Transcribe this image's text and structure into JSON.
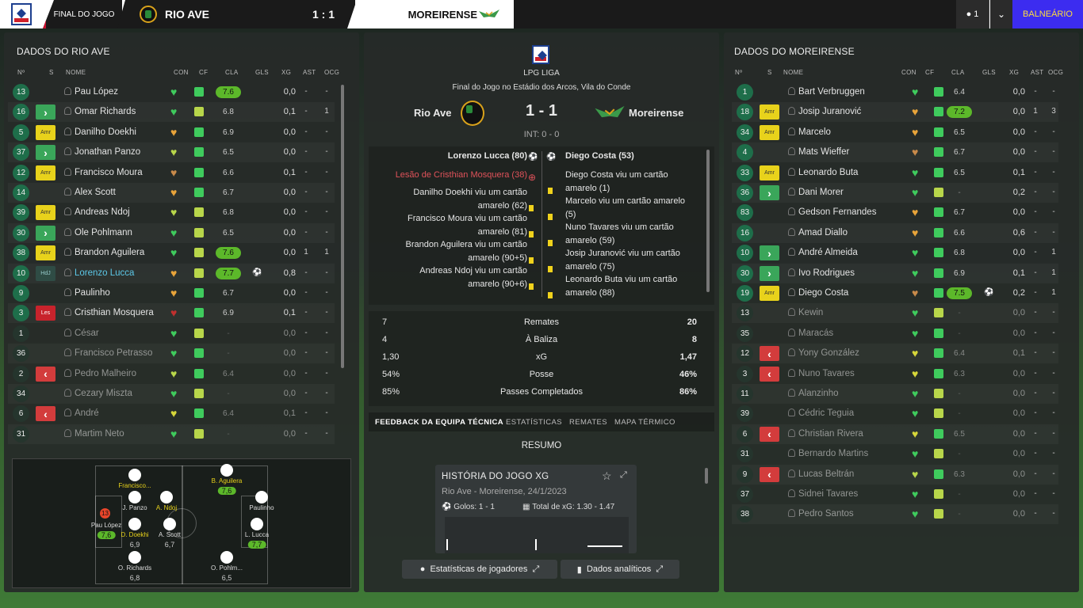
{
  "topbar": {
    "status": "FINAL DO JOGO",
    "home_team": "RIO AVE",
    "score": "1 : 1",
    "away_team": "MOREIRENSE",
    "user_count": "1",
    "action_label": "BALNEÁRIO"
  },
  "left": {
    "title": "DADOS DO RIO AVE",
    "headers": {
      "num": "Nº",
      "s": "S",
      "name": "NOME",
      "con": "CON",
      "cf": "CF",
      "cla": "CLA",
      "gls": "GLS",
      "xg": "XG",
      "ast": "AST",
      "ocg": "OCG"
    },
    "players": [
      {
        "num": "13",
        "status": "",
        "name": "Pau López",
        "cla": "7.6",
        "hi": true,
        "xg": "0,0",
        "ast": "-",
        "ocg": "-",
        "con": "#3fcb5d",
        "cf": "ok",
        "sub": false
      },
      {
        "num": "16",
        "status": "in",
        "name": "Omar Richards",
        "cla": "6.8",
        "xg": "0,1",
        "ast": "-",
        "ocg": "1",
        "con": "#3fcb5d",
        "cf": "mid",
        "sub": false
      },
      {
        "num": "5",
        "status": "Amr",
        "name": "Danilho Doekhi",
        "cla": "6.9",
        "xg": "0,0",
        "ast": "-",
        "ocg": "-",
        "con": "#e8a43a",
        "cf": "ok",
        "sub": false
      },
      {
        "num": "37",
        "status": "in",
        "name": "Jonathan Panzo",
        "cla": "6.5",
        "xg": "0,0",
        "ast": "-",
        "ocg": "-",
        "con": "#b8d64a",
        "cf": "ok",
        "sub": false
      },
      {
        "num": "12",
        "status": "Amr",
        "name": "Francisco Moura",
        "cla": "6.6",
        "xg": "0,1",
        "ast": "-",
        "ocg": "-",
        "con": "#c88a4a",
        "cf": "ok",
        "sub": false
      },
      {
        "num": "14",
        "status": "",
        "name": "Alex Scott",
        "cla": "6.7",
        "xg": "0,0",
        "ast": "-",
        "ocg": "-",
        "con": "#e8a43a",
        "cf": "ok",
        "sub": false
      },
      {
        "num": "39",
        "status": "Amr",
        "name": "Andreas Ndoj",
        "cla": "6.8",
        "xg": "0,0",
        "ast": "-",
        "ocg": "-",
        "con": "#b8d64a",
        "cf": "mid",
        "sub": false
      },
      {
        "num": "30",
        "status": "in",
        "name": "Ole Pohlmann",
        "cla": "6.5",
        "xg": "0,0",
        "ast": "-",
        "ocg": "-",
        "con": "#3fcb5d",
        "cf": "mid",
        "sub": false
      },
      {
        "num": "38",
        "status": "Amr",
        "name": "Brandon Aguilera",
        "cla": "7.6",
        "hi": true,
        "xg": "0,0",
        "ast": "1",
        "ocg": "1",
        "con": "#3fcb5d",
        "cf": "mid",
        "sub": false
      },
      {
        "num": "10",
        "status": "HdJ",
        "name": "Lorenzo Lucca",
        "cla": "7.7",
        "hi": true,
        "ball": true,
        "xg": "0,8",
        "ast": "-",
        "ocg": "-",
        "con": "#e8a43a",
        "cf": "mid",
        "sub": false,
        "highlight": true
      },
      {
        "num": "9",
        "status": "",
        "name": "Paulinho",
        "cla": "6.7",
        "xg": "0,0",
        "ast": "-",
        "ocg": "-",
        "con": "#e8a43a",
        "cf": "ok",
        "sub": false
      },
      {
        "num": "3",
        "status": "Les",
        "name": "Cristhian Mosquera",
        "cla": "6.9",
        "xg": "0,1",
        "ast": "-",
        "ocg": "-",
        "con": "#c0302e",
        "cf": "ok",
        "sub": false
      },
      {
        "num": "1",
        "status": "",
        "name": "César",
        "cla": "-",
        "xg": "0,0",
        "ast": "-",
        "ocg": "-",
        "con": "#3fcb5d",
        "cf": "mid",
        "sub": true
      },
      {
        "num": "36",
        "status": "",
        "name": "Francisco Petrasso",
        "cla": "-",
        "xg": "0,0",
        "ast": "-",
        "ocg": "-",
        "con": "#3fcb5d",
        "cf": "ok",
        "sub": true
      },
      {
        "num": "2",
        "status": "out",
        "name": "Pedro Malheiro",
        "cla": "6.4",
        "xg": "0,0",
        "ast": "-",
        "ocg": "-",
        "con": "#b8d64a",
        "cf": "ok",
        "sub": true
      },
      {
        "num": "34",
        "status": "",
        "name": "Cezary Miszta",
        "cla": "-",
        "xg": "0,0",
        "ast": "-",
        "ocg": "-",
        "con": "#3fcb5d",
        "cf": "mid",
        "sub": true
      },
      {
        "num": "6",
        "status": "out",
        "name": "André",
        "cla": "6.4",
        "xg": "0,1",
        "ast": "-",
        "ocg": "-",
        "con": "#d6d63a",
        "cf": "ok",
        "sub": true
      },
      {
        "num": "31",
        "status": "",
        "name": "Martim Neto",
        "cla": "-",
        "xg": "0,0",
        "ast": "-",
        "ocg": "-",
        "con": "#3fcb5d",
        "cf": "mid",
        "sub": true
      }
    ],
    "pitch": [
      {
        "label": "Francisco...",
        "rate": "",
        "yellow": true
      },
      {
        "label": "J. Panzo",
        "rate": ""
      },
      {
        "label": "A. Ndoj",
        "rate": "",
        "yellow": true
      },
      {
        "label": "D. Doekhi",
        "rate": "6,9",
        "yellow": true
      },
      {
        "label": "A. Scott",
        "rate": "6,7"
      },
      {
        "label": "Pau López",
        "rate": "7,6",
        "green": true
      },
      {
        "label": "O. Richards",
        "rate": "6,8"
      },
      {
        "label": "B. Aguilera",
        "rate": "7,6",
        "green": true,
        "yellow": true
      },
      {
        "label": "O. Pohlm...",
        "rate": "6,5"
      },
      {
        "label": "Paulinho",
        "rate": ""
      },
      {
        "label": "L. Lucca",
        "rate": "7,7",
        "green": true
      }
    ],
    "gk_number": "13"
  },
  "middle": {
    "competition": "LPG LIGA",
    "venue": "Final do Jogo no Estádio dos Arcos, Vila do Conde",
    "home": "Rio Ave",
    "away": "Moreirense",
    "score": "1 - 1",
    "halftime": "INT: 0 - 0",
    "home_events": [
      {
        "text": "Lorenzo Lucca (80)",
        "type": "goal"
      },
      {
        "text": "Lesão de Cristhian Mosquera (38)",
        "type": "injury"
      },
      {
        "text": "Danilho Doekhi viu um cartão",
        "text2": "amarelo (62)",
        "type": "yellow"
      },
      {
        "text": "Francisco Moura viu um cartão",
        "text2": "amarelo (81)",
        "type": "yellow"
      },
      {
        "text": "Brandon Aguilera viu um cartão",
        "text2": "amarelo (90+5)",
        "type": "yellow"
      },
      {
        "text": "Andreas Ndoj viu um cartão",
        "text2": "amarelo (90+6)",
        "type": "yellow"
      }
    ],
    "away_events": [
      {
        "text": "Diego Costa (53)",
        "type": "goal"
      },
      {
        "text": "Diego Costa viu um cartão",
        "text2": "amarelo (1)",
        "type": "yellow"
      },
      {
        "text": "Marcelo viu um cartão amarelo",
        "text2": "(5)",
        "type": "yellow"
      },
      {
        "text": "Nuno Tavares viu um cartão",
        "text2": "amarelo (59)",
        "type": "yellow"
      },
      {
        "text": "Josip Juranović viu um cartão",
        "text2": "amarelo (75)",
        "type": "yellow"
      },
      {
        "text": "Leonardo Buta viu um cartão",
        "text2": "amarelo (88)",
        "type": "yellow"
      }
    ],
    "stats": [
      {
        "home": "7",
        "label": "Remates",
        "away": "20"
      },
      {
        "home": "4",
        "label": "À Baliza",
        "away": "8"
      },
      {
        "home": "1,30",
        "label": "xG",
        "away": "1,47"
      },
      {
        "home": "54%",
        "label": "Posse",
        "away": "46%"
      },
      {
        "home": "85%",
        "label": "Passes Completados",
        "away": "86%"
      }
    ],
    "tabs": [
      "FEEDBACK DA EQUIPA TÉCNICA",
      "ESTATÍSTICAS",
      "REMATES",
      "MAPA TÉRMICO"
    ],
    "resumo": "RESUMO",
    "card": {
      "title": "HISTÓRIA DO JOGO XG",
      "subtitle": "Rio Ave - Moreirense, 24/1/2023",
      "goals": "Golos: 1 - 1",
      "xg_total": "Total de xG: 1.30 - 1.47"
    },
    "btn_players": "Estatísticas de jogadores",
    "btn_analytics": "Dados analíticos"
  },
  "right": {
    "title": "DADOS DO MOREIRENSE",
    "headers": {
      "num": "Nº",
      "s": "S",
      "name": "NOME",
      "con": "CON",
      "cf": "CF",
      "cla": "CLA",
      "gls": "GLS",
      "xg": "XG",
      "ast": "AST",
      "ocg": "OCG"
    },
    "players": [
      {
        "num": "1",
        "status": "",
        "name": "Bart Verbruggen",
        "cla": "6.4",
        "xg": "0,0",
        "ast": "-",
        "ocg": "-",
        "con": "#3fcb5d",
        "cf": "ok",
        "sub": false
      },
      {
        "num": "18",
        "status": "Amr",
        "name": "Josip Juranović",
        "cla": "7.2",
        "hi": true,
        "xg": "0,0",
        "ast": "1",
        "ocg": "3",
        "con": "#e8a43a",
        "cf": "ok",
        "sub": false
      },
      {
        "num": "34",
        "status": "Amr",
        "name": "Marcelo",
        "cla": "6.5",
        "xg": "0,0",
        "ast": "-",
        "ocg": "-",
        "con": "#e8a43a",
        "cf": "ok",
        "sub": false
      },
      {
        "num": "4",
        "status": "",
        "name": "Mats Wieffer",
        "cla": "6.7",
        "xg": "0,0",
        "ast": "-",
        "ocg": "-",
        "con": "#c88a4a",
        "cf": "ok",
        "sub": false
      },
      {
        "num": "33",
        "status": "Amr",
        "name": "Leonardo Buta",
        "cla": "6.5",
        "xg": "0,1",
        "ast": "-",
        "ocg": "-",
        "con": "#3fcb5d",
        "cf": "ok",
        "sub": false
      },
      {
        "num": "36",
        "status": "in",
        "name": "Dani Morer",
        "cla": "-",
        "xg": "0,2",
        "ast": "-",
        "ocg": "-",
        "con": "#3fcb5d",
        "cf": "mid",
        "sub": false
      },
      {
        "num": "83",
        "status": "",
        "name": "Gedson Fernandes",
        "cla": "6.7",
        "xg": "0,0",
        "ast": "-",
        "ocg": "-",
        "con": "#e8a43a",
        "cf": "ok",
        "sub": false
      },
      {
        "num": "16",
        "status": "",
        "name": "Amad Diallo",
        "cla": "6.6",
        "xg": "0,6",
        "ast": "-",
        "ocg": "-",
        "con": "#e8a43a",
        "cf": "ok",
        "sub": false
      },
      {
        "num": "10",
        "status": "in",
        "name": "André Almeida",
        "cla": "6.8",
        "xg": "0,0",
        "ast": "-",
        "ocg": "1",
        "con": "#3fcb5d",
        "cf": "ok",
        "sub": false
      },
      {
        "num": "30",
        "status": "in",
        "name": "Ivo Rodrigues",
        "cla": "6.9",
        "xg": "0,1",
        "ast": "-",
        "ocg": "1",
        "con": "#3fcb5d",
        "cf": "ok",
        "sub": false
      },
      {
        "num": "19",
        "status": "Amr",
        "name": "Diego Costa",
        "cla": "7.5",
        "hi": true,
        "ball": true,
        "xg": "0,2",
        "ast": "-",
        "ocg": "1",
        "con": "#c88a4a",
        "cf": "ok",
        "sub": false
      },
      {
        "num": "13",
        "status": "",
        "name": "Kewin",
        "cla": "-",
        "xg": "0,0",
        "ast": "-",
        "ocg": "-",
        "con": "#3fcb5d",
        "cf": "mid",
        "sub": true
      },
      {
        "num": "35",
        "status": "",
        "name": "Maracás",
        "cla": "-",
        "xg": "0,0",
        "ast": "-",
        "ocg": "-",
        "con": "#3fcb5d",
        "cf": "ok",
        "sub": true
      },
      {
        "num": "12",
        "status": "out",
        "name": "Yony González",
        "cla": "6.4",
        "xg": "0,1",
        "ast": "-",
        "ocg": "-",
        "con": "#d6d63a",
        "cf": "ok",
        "sub": true
      },
      {
        "num": "3",
        "status": "out",
        "name": "Nuno Tavares",
        "cla": "6.3",
        "xg": "0,0",
        "ast": "-",
        "ocg": "-",
        "con": "#d6d63a",
        "cf": "ok",
        "sub": true
      },
      {
        "num": "11",
        "status": "",
        "name": "Alanzinho",
        "cla": "-",
        "xg": "0,0",
        "ast": "-",
        "ocg": "-",
        "con": "#3fcb5d",
        "cf": "mid",
        "sub": true
      },
      {
        "num": "39",
        "status": "",
        "name": "Cédric Teguia",
        "cla": "-",
        "xg": "0,0",
        "ast": "-",
        "ocg": "-",
        "con": "#3fcb5d",
        "cf": "mid",
        "sub": true
      },
      {
        "num": "6",
        "status": "out",
        "name": "Christian Rivera",
        "cla": "6.5",
        "xg": "0,0",
        "ast": "-",
        "ocg": "-",
        "con": "#d6d63a",
        "cf": "ok",
        "sub": true
      },
      {
        "num": "31",
        "status": "",
        "name": "Bernardo Martins",
        "cla": "-",
        "xg": "0,0",
        "ast": "-",
        "ocg": "-",
        "con": "#3fcb5d",
        "cf": "mid",
        "sub": true
      },
      {
        "num": "9",
        "status": "out",
        "name": "Lucas Beltrán",
        "cla": "6.3",
        "xg": "0,0",
        "ast": "-",
        "ocg": "-",
        "con": "#b8d64a",
        "cf": "ok",
        "sub": true
      },
      {
        "num": "37",
        "status": "",
        "name": "Sidnei Tavares",
        "cla": "-",
        "xg": "0,0",
        "ast": "-",
        "ocg": "-",
        "con": "#3fcb5d",
        "cf": "mid",
        "sub": true
      },
      {
        "num": "38",
        "status": "",
        "name": "Pedro Santos",
        "cla": "-",
        "xg": "0,0",
        "ast": "-",
        "ocg": "-",
        "con": "#3fcb5d",
        "cf": "mid",
        "sub": true
      }
    ]
  }
}
